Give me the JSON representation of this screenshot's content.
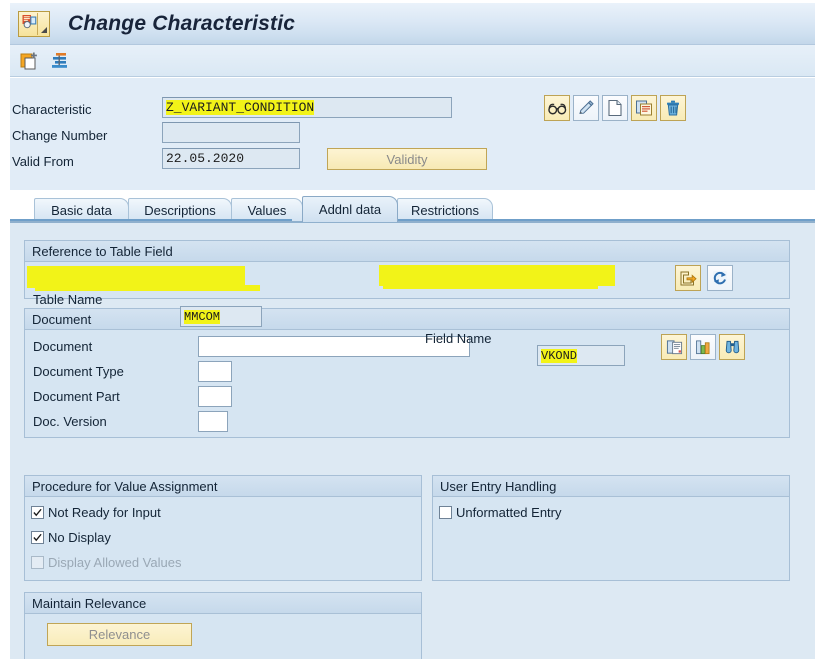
{
  "window": {
    "title": "Change Characteristic",
    "system_icon": "sap-session-icon",
    "dropdown_icon": "chevron-down-icon"
  },
  "toolbar": {
    "buttons": [
      {
        "name": "create-new-icon",
        "label": ""
      },
      {
        "name": "hierarchy-list-icon",
        "label": ""
      }
    ]
  },
  "header": {
    "fields": [
      {
        "label": "Characteristic",
        "value": "Z_VARIANT_CONDITION",
        "highlighted": true
      },
      {
        "label": "Change Number",
        "value": "",
        "highlighted": false
      },
      {
        "label": "Valid From",
        "value": "22.05.2020",
        "highlighted": false
      }
    ],
    "validity_button": "Validity",
    "action_icons": [
      {
        "name": "display-glasses-icon"
      },
      {
        "name": "edit-pencil-icon"
      },
      {
        "name": "create-page-icon"
      },
      {
        "name": "copy-icon"
      },
      {
        "name": "delete-trash-icon"
      }
    ]
  },
  "tabs": [
    {
      "label": "Basic data",
      "active": false
    },
    {
      "label": "Descriptions",
      "active": false
    },
    {
      "label": "Values",
      "active": false
    },
    {
      "label": "Addnl data",
      "active": true
    },
    {
      "label": "Restrictions",
      "active": false
    }
  ],
  "reference_group": {
    "title": "Reference to Table Field",
    "table_name_label": "Table Name",
    "table_name_value": "MMCOM",
    "field_name_label": "Field Name",
    "field_name_value": "VKOND",
    "icons": [
      {
        "name": "goto-export-icon"
      },
      {
        "name": "refresh-sync-icon"
      }
    ]
  },
  "document_group": {
    "title": "Document",
    "rows": [
      {
        "label": "Document",
        "value": ""
      },
      {
        "label": "Document Type",
        "value": ""
      },
      {
        "label": "Document Part",
        "value": ""
      },
      {
        "label": "Doc. Version",
        "value": ""
      }
    ],
    "icons": [
      {
        "name": "document-details-icon"
      },
      {
        "name": "document-structure-icon"
      },
      {
        "name": "find-binoculars-icon"
      }
    ]
  },
  "procedure_group": {
    "title": "Procedure for Value Assignment",
    "checkboxes": [
      {
        "label": "Not Ready for Input",
        "checked": true,
        "disabled": false
      },
      {
        "label": "No Display",
        "checked": true,
        "disabled": false
      },
      {
        "label": "Display Allowed Values",
        "checked": false,
        "disabled": true
      }
    ]
  },
  "user_entry_group": {
    "title": "User Entry Handling",
    "checkboxes": [
      {
        "label": "Unformatted Entry",
        "checked": false,
        "disabled": false
      }
    ]
  },
  "relevance_group": {
    "title": "Maintain Relevance",
    "button_label": "Relevance"
  },
  "colors": {
    "page_background": "#dde9f3",
    "highlight": "#f2f318",
    "accent": "#6f9fc9",
    "field_background": "#dde8f2"
  }
}
